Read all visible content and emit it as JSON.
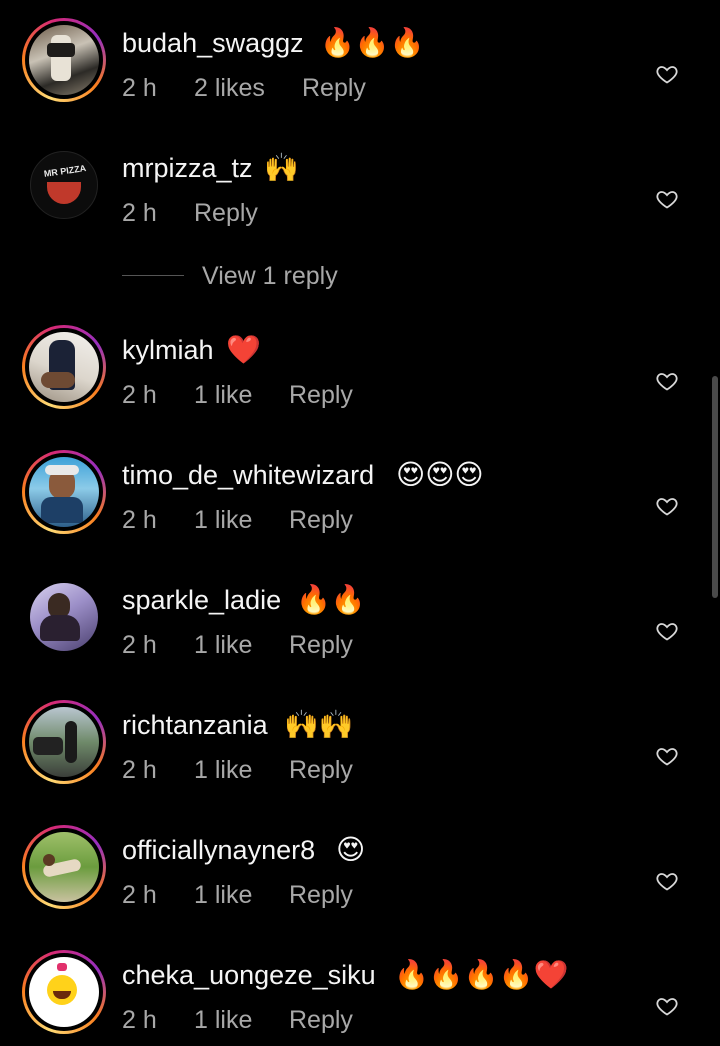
{
  "comments": [
    {
      "username": "budah_swaggz",
      "emojis": "🔥🔥🔥",
      "time": "2 h",
      "likes": "2 likes",
      "reply": "Reply"
    },
    {
      "username": "mrpizza_tz",
      "emojis": "🙌",
      "time": "2 h",
      "likes": "",
      "reply": "Reply",
      "avatar_text": "MR PIZZA"
    },
    {
      "username": "kylmiah",
      "emojis": "❤️",
      "time": "2 h",
      "likes": "1 like",
      "reply": "Reply"
    },
    {
      "username": "timo_de_whitewizard",
      "emojis": "😍😍😍",
      "time": "2 h",
      "likes": "1 like",
      "reply": "Reply"
    },
    {
      "username": "sparkle_ladie",
      "emojis": "🔥🔥",
      "time": "2 h",
      "likes": "1 like",
      "reply": "Reply"
    },
    {
      "username": "richtanzania",
      "emojis": "🙌🙌",
      "time": "2 h",
      "likes": "1 like",
      "reply": "Reply"
    },
    {
      "username": "officiallynayner8",
      "emojis": "😍",
      "time": "2 h",
      "likes": "1 like",
      "reply": "Reply"
    },
    {
      "username": "cheka_uongeze_siku",
      "emojis": "🔥🔥🔥🔥❤️",
      "time": "2 h",
      "likes": "1 like",
      "reply": "Reply"
    }
  ],
  "view_replies": "View 1 reply",
  "icons": {
    "like": "heart-outline-icon"
  },
  "colors": {
    "background": "#000000",
    "text": "#f5f5f5",
    "secondary": "#a8a8a8"
  }
}
